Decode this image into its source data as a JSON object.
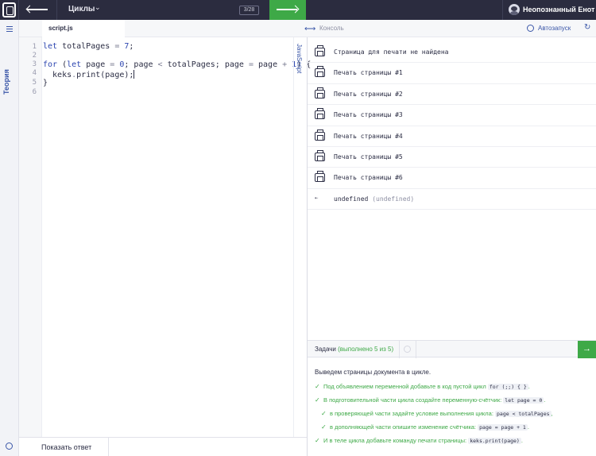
{
  "header": {
    "section_title": "Циклы",
    "progress": "3/28",
    "username": "Неопознанный Енот"
  },
  "sidebar": {
    "theory_label": "Теория"
  },
  "editor": {
    "file_tab": "script.js",
    "language": "JavaScript",
    "line_numbers": [
      "1",
      "2",
      "3",
      "4",
      "5",
      "6"
    ],
    "show_answer": "Показать ответ"
  },
  "console": {
    "title": "Консоль",
    "autorun": "Автозапуск",
    "logs": [
      "Страница для печати не найдена",
      "Печать страницы #1",
      "Печать страницы #2",
      "Печать страницы #3",
      "Печать страницы #4",
      "Печать страницы #5",
      "Печать страницы #6"
    ],
    "return_value": "undefined",
    "return_type": "(undefined)",
    "return_arrow": "⇠"
  },
  "tasks": {
    "title": "Задачи",
    "count": "(выполнено 5 из 5)",
    "intro": "Выведем страницы документа в цикле.",
    "items": [
      {
        "text": "Под объявлением переменной добавьте в код пустой цикл",
        "code": "for (;;) { }",
        "suffix": "."
      },
      {
        "text": "В подготовительной части цикла создайте переменную-счётчик:",
        "code": "let page = 0",
        "suffix": "."
      },
      {
        "text": "в проверяющей части задайте условие выполнения цикла:",
        "code": "page < totalPages",
        "suffix": ","
      },
      {
        "text": "в дополняющей части опишите изменение счётчика:",
        "code": "page = page + 1",
        "suffix": "."
      },
      {
        "text": "И в теле цикла добавьте команду печати страницы:",
        "code": "keks.print(page)",
        "suffix": "."
      }
    ],
    "check_mark": "✓"
  },
  "icons": {
    "logo": "shield-logo-icon",
    "back": "arrow-left-icon",
    "next": "arrow-right-icon",
    "menu": "menu-icon",
    "settings": "gear-icon",
    "swap": "swap-icon",
    "refresh": "refresh-icon",
    "printer": "printer-icon"
  },
  "colors": {
    "topbar": "#2b2c3f",
    "accent_green": "#3ea947",
    "accent_blue": "#3a56a8",
    "keyword": "#2c45b0"
  }
}
